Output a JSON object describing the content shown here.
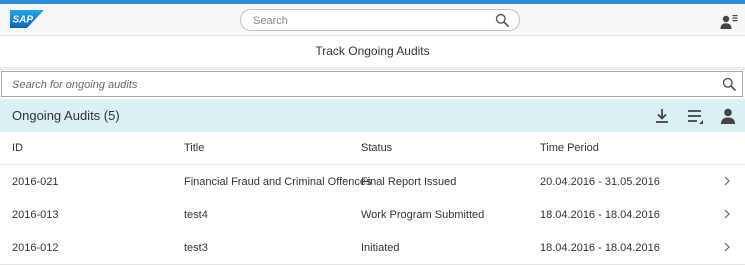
{
  "shell": {
    "logo_text": "SAP",
    "search_placeholder": "Search",
    "brand_color": "#2b8fd6"
  },
  "page": {
    "title": "Track Ongoing Audits"
  },
  "list_search": {
    "placeholder": "Search for ongoing audits"
  },
  "table": {
    "title": "Ongoing Audits (5)",
    "toolbar_icons": [
      "download-icon",
      "sort-settings-icon",
      "person-icon"
    ],
    "columns": [
      "ID",
      "Title",
      "Status",
      "Time Period"
    ],
    "rows": [
      {
        "id": "2016-021",
        "title": "Financial Fraud and Criminal Offences",
        "status": "Final Report Issued",
        "period": "20.04.2016 - 31.05.2016"
      },
      {
        "id": "2016-013",
        "title": "test4",
        "status": "Work Program Submitted",
        "period": "18.04.2016 - 18.04.2016"
      },
      {
        "id": "2016-012",
        "title": "test3",
        "status": "Initiated",
        "period": "18.04.2016 - 18.04.2016"
      }
    ]
  },
  "colors": {
    "header_bar": "#daf1f4",
    "shell_bg": "#f7f7f7"
  }
}
